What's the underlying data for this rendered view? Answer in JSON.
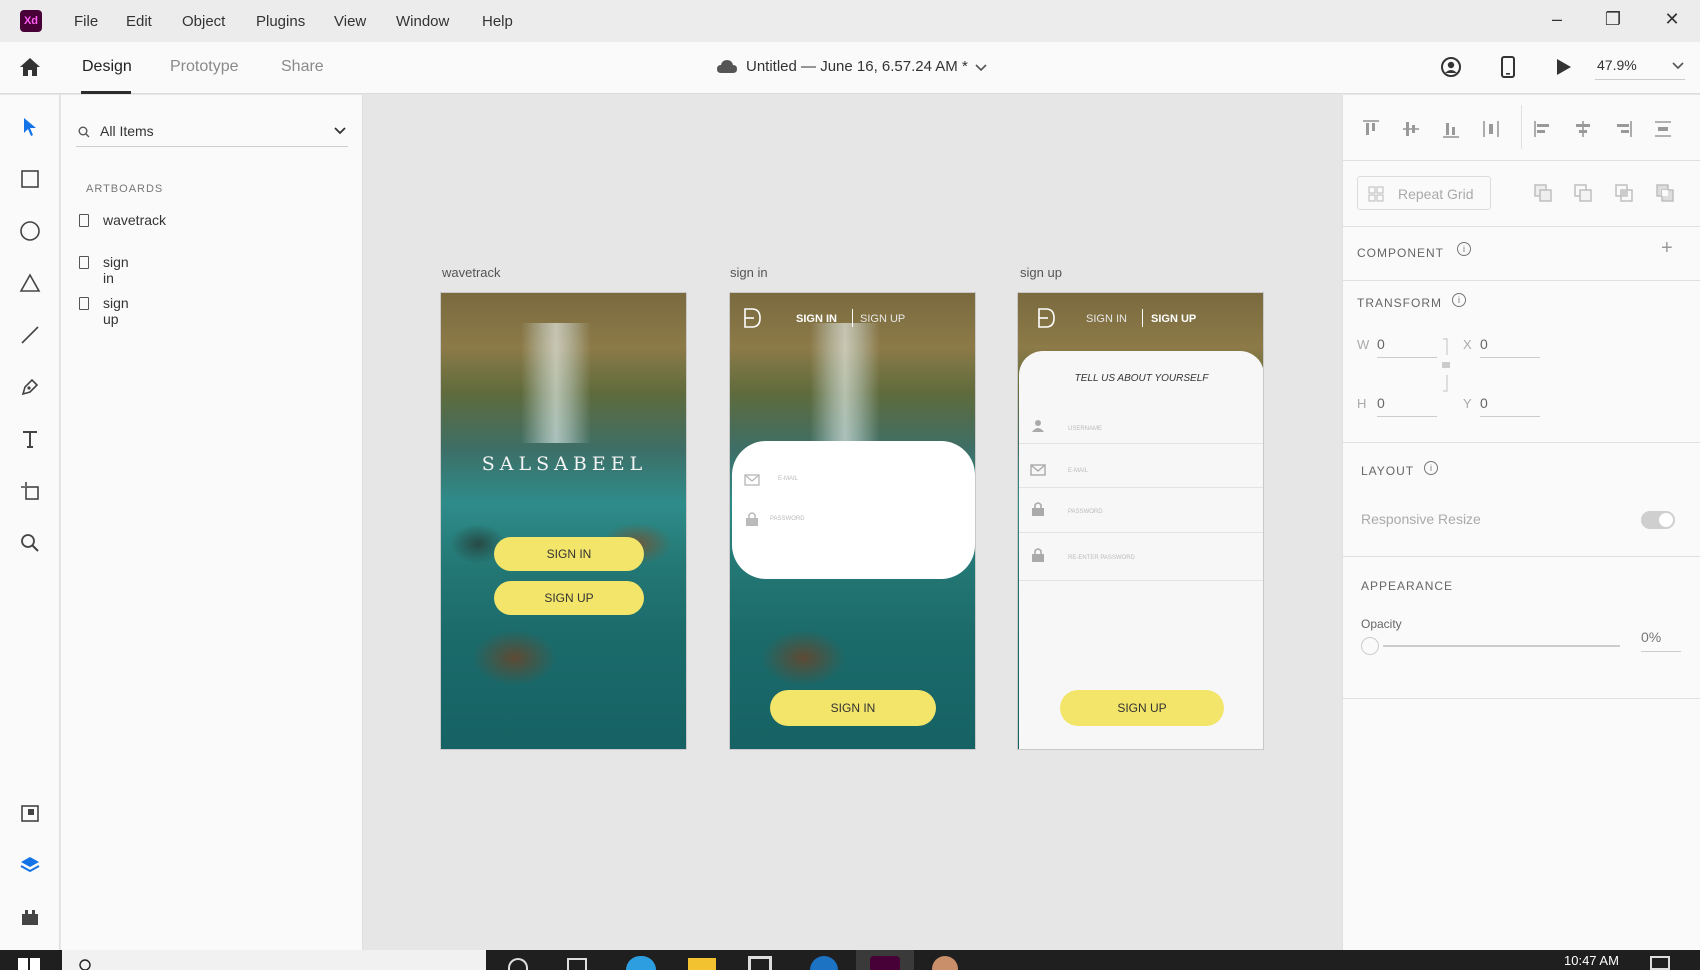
{
  "menubar": {
    "logo": "Xd",
    "items": [
      "File",
      "Edit",
      "Object",
      "Plugins",
      "View",
      "Window",
      "Help"
    ]
  },
  "toolbar": {
    "tabs": [
      "Design",
      "Prototype",
      "Share"
    ],
    "active_tab": "Design",
    "doc_title": "Untitled — June 16, 6.57.24 AM *",
    "zoom": "47.9%"
  },
  "layers": {
    "filter": "All Items",
    "section": "ARTBOARDS",
    "artboards": [
      "wavetrack",
      "sign in",
      "sign up"
    ]
  },
  "canvas": {
    "artboards": [
      {
        "label": "wavetrack",
        "brand": "SALSABEEL",
        "sign_in": "SIGN IN",
        "sign_up": "SIGN UP"
      },
      {
        "label": "sign in",
        "tab_signin": "SIGN IN",
        "tab_signup": "SIGN UP",
        "email_placeholder": "E-MAIL",
        "password_placeholder": "PASSWORD",
        "button": "SIGN IN"
      },
      {
        "label": "sign up",
        "tab_signin": "SIGN IN",
        "tab_signup": "SIGN UP",
        "heading": "TELL US ABOUT YOURSELF",
        "username_placeholder": "USERNAME",
        "email_placeholder": "E-MAIL",
        "password_placeholder": "PASSWORD",
        "reenter_placeholder": "RE-ENTER PASSWORD",
        "button": "SIGN UP"
      }
    ]
  },
  "props": {
    "repeat_grid": "Repeat Grid",
    "component": "COMPONENT",
    "transform": "TRANSFORM",
    "w_label": "W",
    "w_value": "0",
    "x_label": "X",
    "x_value": "0",
    "h_label": "H",
    "h_value": "0",
    "y_label": "Y",
    "y_value": "0",
    "layout": "LAYOUT",
    "responsive_resize": "Responsive Resize",
    "appearance": "APPEARANCE",
    "opacity_label": "Opacity",
    "opacity_value": "0%"
  },
  "taskbar": {
    "clock": "10:47 AM"
  },
  "colors": {
    "accent_blue": "#1473e6",
    "button_yellow": "#f2e56a",
    "xd_purple": "#470137"
  }
}
